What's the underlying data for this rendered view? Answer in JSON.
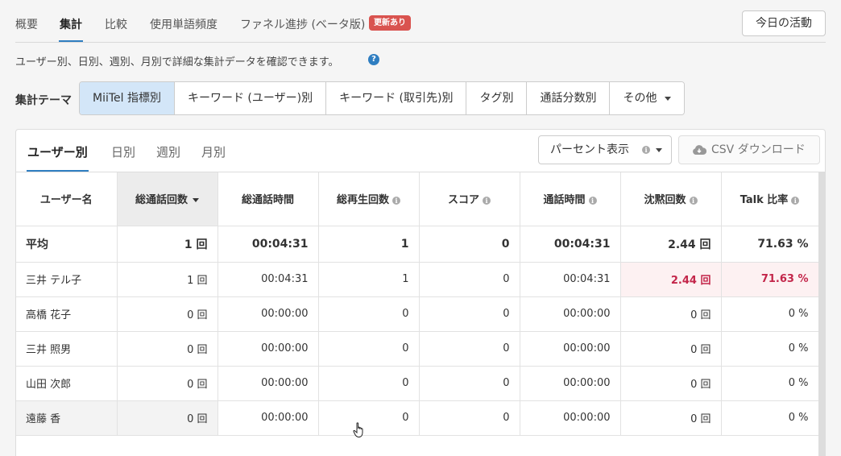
{
  "top_tabs": [
    {
      "label": "概要"
    },
    {
      "label": "集計"
    },
    {
      "label": "比較"
    },
    {
      "label": "使用単語頻度"
    },
    {
      "label": "ファネル進捗 (ベータ版)"
    }
  ],
  "badge_new": "更新あり",
  "today_button": "今日の活動",
  "description": "ユーザー別、日別、週別、月別で詳細な集計データを確認できます。",
  "help_icon": "?",
  "theme": {
    "label": "集計テーマ",
    "options": [
      "MiiTel 指標別",
      "キーワード (ユーザー)別",
      "キーワード (取引先)別",
      "タグ別",
      "通話分数別",
      "その他"
    ]
  },
  "sub_tabs": [
    "ユーザー別",
    "日別",
    "週別",
    "月別"
  ],
  "percent_button": "パーセント表示",
  "csv_button": "CSV ダウンロード",
  "table": {
    "headers": [
      "ユーザー名",
      "総通話回数",
      "総通話時間",
      "総再生回数",
      "スコア",
      "通話時間",
      "沈黙回数",
      "Talk 比率"
    ],
    "average": [
      "平均",
      "1 回",
      "00:04:31",
      "1",
      "0",
      "00:04:31",
      "2.44 回",
      "71.63 %"
    ],
    "rows": [
      [
        "三井 テル子",
        "1 回",
        "00:04:31",
        "1",
        "0",
        "00:04:31",
        "2.44 回",
        "71.63 %"
      ],
      [
        "高橋 花子",
        "0 回",
        "00:00:00",
        "0",
        "0",
        "00:00:00",
        "0 回",
        "0 %"
      ],
      [
        "三井 照男",
        "0 回",
        "00:00:00",
        "0",
        "0",
        "00:00:00",
        "0 回",
        "0 %"
      ],
      [
        "山田 次郎",
        "0 回",
        "00:00:00",
        "0",
        "0",
        "00:00:00",
        "0 回",
        "0 %"
      ],
      [
        "遠藤 香",
        "0 回",
        "00:00:00",
        "0",
        "0",
        "00:00:00",
        "0 回",
        "0 %"
      ]
    ]
  },
  "colors": {
    "accent": "#2f7ec1",
    "badge": "#d9534f",
    "highlight_text": "#c3264a",
    "highlight_bg": "#fdf1f2"
  }
}
